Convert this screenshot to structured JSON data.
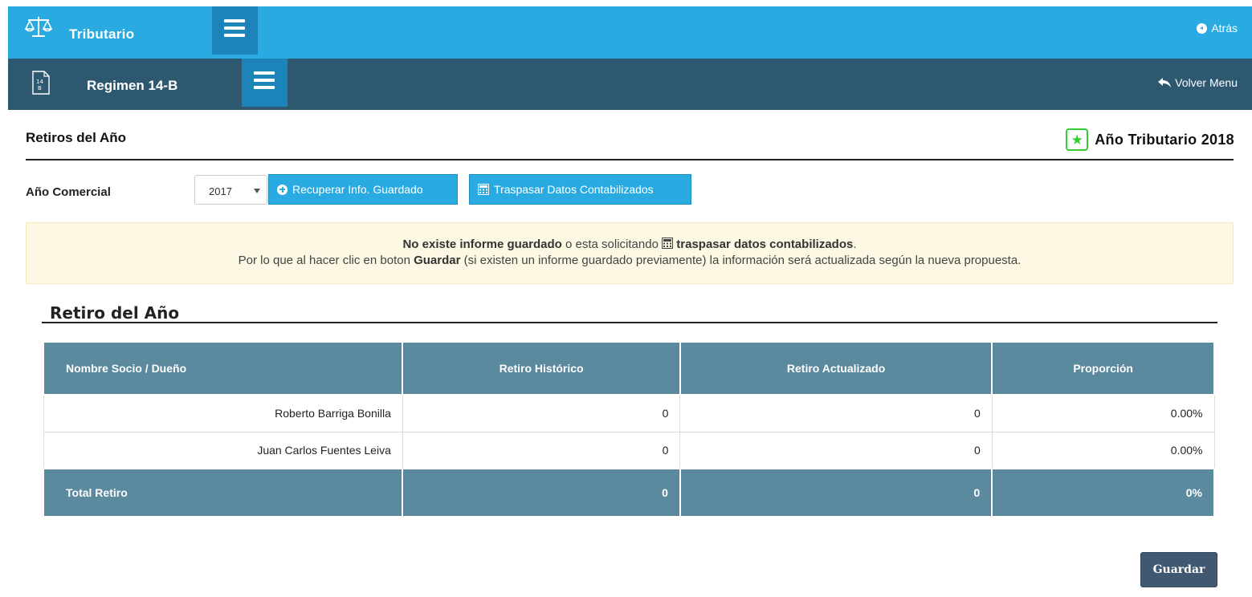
{
  "topbar": {
    "app_title": "Tributario",
    "back_label": "Atrás",
    "logo_icon": "scale-icon",
    "menu_icon": "hamburger-icon"
  },
  "subbar": {
    "title": "Regimen 14-B",
    "doc_icon_text_top": "14",
    "doc_icon_text_bottom": "B",
    "volver_label": "Volver Menu"
  },
  "header": {
    "title": "Retiros del Año",
    "year_badge": "Año Tributario 2018"
  },
  "controls": {
    "anio_label": "Año Comercial",
    "selected_year": "2017",
    "recuperar_label": "Recuperar Info. Guardado",
    "traspasar_label": "Traspasar Datos Contabilizados"
  },
  "alert": {
    "line1_bold1": "No existe informe guardado",
    "line1_text": " o esta solicitando ",
    "line1_bold2": "traspasar datos contabilizados",
    "line1_end": ".",
    "line2_start": "Por lo que al hacer clic en boton ",
    "line2_bold": "Guardar",
    "line2_end": " (si existen un informe guardado previamente) la información será actualizada según la nueva propuesta."
  },
  "section": {
    "title": "Retiro del Año"
  },
  "table": {
    "headers": [
      "Nombre Socio / Dueño",
      "Retiro Histórico",
      "Retiro Actualizado",
      "Proporción"
    ],
    "rows": [
      [
        "Roberto Barriga Bonilla",
        "0",
        "0",
        "0.00%"
      ],
      [
        "Juan Carlos Fuentes Leiva",
        "0",
        "0",
        "0.00%"
      ]
    ],
    "total": [
      "Total Retiro",
      "0",
      "0",
      "0%"
    ]
  },
  "actions": {
    "guardar_label": "Guardar"
  },
  "colors": {
    "topbar": "#29abe2",
    "subbar": "#2e5870",
    "table_header": "#5b899d",
    "alert_bg": "#fcf8e3",
    "star": "#33cc33"
  }
}
